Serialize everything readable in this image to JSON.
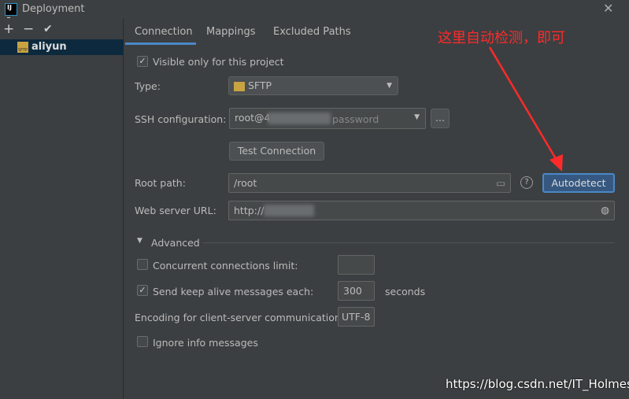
{
  "window": {
    "title": "Deployment"
  },
  "toolbar": {
    "add": "+",
    "remove": "−",
    "apply": "✔"
  },
  "servers": [
    {
      "label": "aliyun",
      "icon": "sftp-icon"
    }
  ],
  "tabs": [
    {
      "label": "Connection",
      "active": true
    },
    {
      "label": "Mappings"
    },
    {
      "label": "Excluded Paths"
    }
  ],
  "form": {
    "visible_only": {
      "label": "Visible only for this project",
      "checked": true
    },
    "type": {
      "label": "Type:",
      "value": "SFTP"
    },
    "ssh": {
      "label": "SSH configuration:",
      "value_prefix": "root@4",
      "value_suffix": "password",
      "more": "..."
    },
    "test_connection": "Test Connection",
    "root_path": {
      "label": "Root path:",
      "value": "/root"
    },
    "help": "?",
    "autodetect": "Autodetect",
    "web_url": {
      "label": "Web server URL:",
      "value": "http://"
    },
    "advanced": "Advanced",
    "concurrent": {
      "label": "Concurrent connections limit:",
      "checked": false,
      "value": ""
    },
    "keepalive": {
      "label": "Send keep alive messages each:",
      "checked": true,
      "value": "300",
      "unit": "seconds"
    },
    "encoding": {
      "label": "Encoding for client-server communication:",
      "value": "UTF-8"
    },
    "ignore_info": {
      "label": "Ignore info messages",
      "checked": false
    }
  },
  "annotation": {
    "text": "这里自动检测，即可",
    "color": "#ff2a2a"
  },
  "watermark": "https://blog.csdn.net/IT_Holmes"
}
